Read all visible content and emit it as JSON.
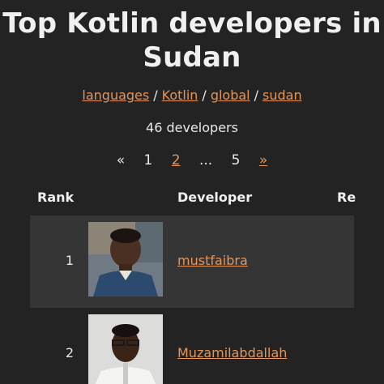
{
  "title": "Top Kotlin developers in Sudan",
  "breadcrumb": {
    "languages": "languages",
    "kotlin": "Kotlin",
    "global": "global",
    "sudan": "sudan",
    "separator": "/"
  },
  "count_text": "46 developers",
  "pagination": {
    "first": "«",
    "page1": "1",
    "page2": "2",
    "ellipsis": "...",
    "page5": "5",
    "next": "»"
  },
  "table": {
    "headers": {
      "rank": "Rank",
      "developer": "Developer",
      "reputation": "Re"
    },
    "rows": [
      {
        "rank": "1",
        "name": "mustfaibra"
      },
      {
        "rank": "2",
        "name": "Muzamilabdallah"
      }
    ]
  },
  "colors": {
    "background": "#232323",
    "row_shade": "#353535",
    "link": "#e3955a",
    "text": "#ececec"
  }
}
